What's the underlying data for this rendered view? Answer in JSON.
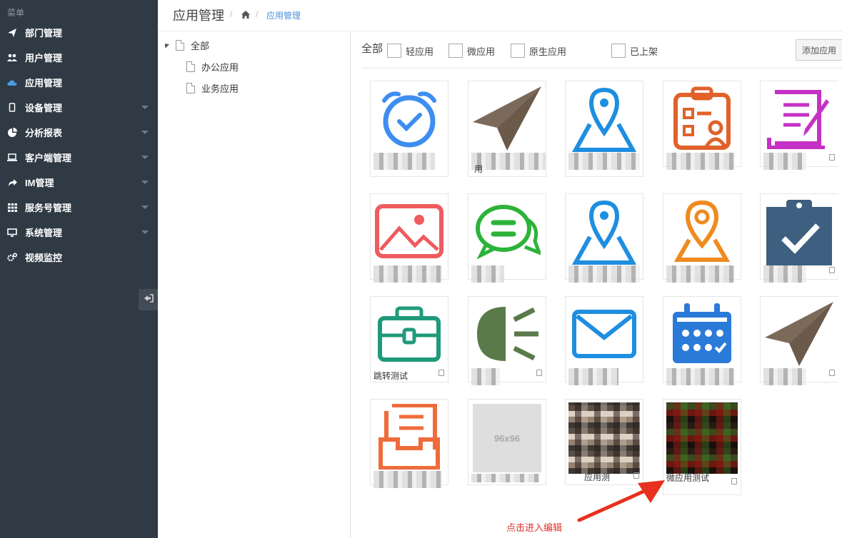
{
  "sidebar": {
    "menu_title": "菜单",
    "items": [
      {
        "label": "部门管理",
        "icon": "paper-plane-icon",
        "has_caret": false
      },
      {
        "label": "用户管理",
        "icon": "users-icon",
        "has_caret": false
      },
      {
        "label": "应用管理",
        "icon": "cloud-icon",
        "has_caret": false
      },
      {
        "label": "设备管理",
        "icon": "tablet-icon",
        "has_caret": true
      },
      {
        "label": "分析报表",
        "icon": "pie-chart-icon",
        "has_caret": true
      },
      {
        "label": "客户端管理",
        "icon": "laptop-icon",
        "has_caret": true
      },
      {
        "label": "IM管理",
        "icon": "share-arrow-icon",
        "has_caret": true
      },
      {
        "label": "服务号管理",
        "icon": "grid-icon",
        "has_caret": true
      },
      {
        "label": "系统管理",
        "icon": "monitor-icon",
        "has_caret": true
      },
      {
        "label": "视频监控",
        "icon": "cogs-icon",
        "has_caret": false
      }
    ]
  },
  "header": {
    "title": "应用管理",
    "breadcrumb_sep": "/",
    "breadcrumb_current": "应用管理"
  },
  "tree": {
    "root": "全部",
    "children": [
      "办公应用",
      "业务应用"
    ]
  },
  "filters": {
    "all": "全部",
    "checkboxes": [
      "轻应用",
      "微应用",
      "原生应用",
      "已上架"
    ],
    "add_button": "添加应用"
  },
  "cards": [
    {
      "name": "",
      "icon": "alarm-clock-icon",
      "color": "#3d8ef0"
    },
    {
      "name": "用",
      "icon": "paper-plane-icon",
      "color": "#7b6a5a"
    },
    {
      "name": "",
      "icon": "map-pin-icon",
      "color": "#1e8ee0"
    },
    {
      "name": "",
      "icon": "clipboard-person-icon",
      "color": "#e0622a"
    },
    {
      "name": "",
      "icon": "document-pen-icon",
      "color": "#c531c5"
    },
    {
      "name": "",
      "icon": "image-icon",
      "color": "#ef5b5f"
    },
    {
      "name": "",
      "icon": "chat-bubbles-icon",
      "color": "#2db33a"
    },
    {
      "name": "",
      "icon": "map-pin-icon",
      "color": "#1e8ee0"
    },
    {
      "name": "",
      "icon": "map-pin-icon",
      "color": "#ef8a1f"
    },
    {
      "name": "",
      "icon": "clipboard-check-icon",
      "color": "#3d5f80"
    },
    {
      "name": "跳转测试",
      "icon": "briefcase-icon",
      "color": "#1f9a7a"
    },
    {
      "name": "",
      "icon": "headlight-icon",
      "color": "#5a7a4a"
    },
    {
      "name": "",
      "icon": "envelope-icon",
      "color": "#1e8ee0"
    },
    {
      "name": "",
      "icon": "calendar-icon",
      "color": "#2a7ad8"
    },
    {
      "name": "",
      "icon": "paper-plane-icon",
      "color": "#7b6a5a"
    },
    {
      "name": "",
      "icon": "inbox-icon",
      "color": "#ef6b3a"
    },
    {
      "name": "",
      "icon": "placeholder-image",
      "color": "#ddd",
      "placeholder": "96x96"
    },
    {
      "name": "应用测",
      "icon": "photo-thumbnail",
      "color": "#333"
    },
    {
      "name": "微应用测试",
      "icon": "photo-thumbnail",
      "color": "#333"
    }
  ],
  "annotation": "点击进入编辑",
  "colors": {
    "sidebar_bg": "#2f3a45",
    "accent": "#4a90d9",
    "annotation": "#e0312a"
  }
}
